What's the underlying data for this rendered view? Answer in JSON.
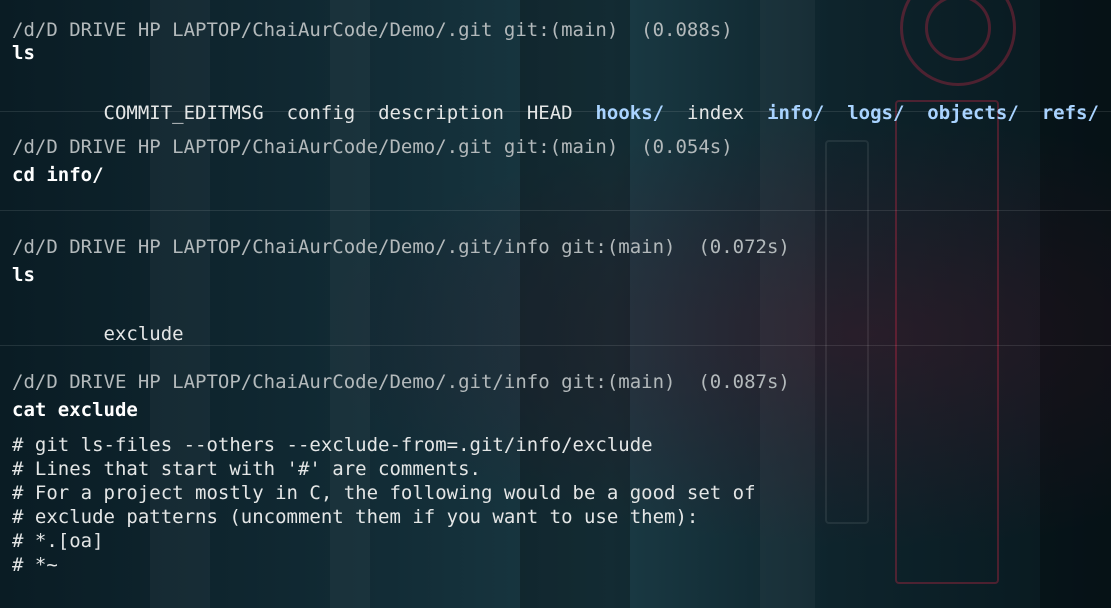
{
  "blocks": [
    {
      "prompt": "/d/D DRIVE HP LAPTOP/ChaiAurCode/Demo/.git git:(main)  (0.088s)",
      "command": "ls",
      "ls_items": [
        {
          "name": "COMMIT_EDITMSG",
          "is_dir": false
        },
        {
          "name": "config",
          "is_dir": false
        },
        {
          "name": "description",
          "is_dir": false
        },
        {
          "name": "HEAD",
          "is_dir": false
        },
        {
          "name": "hooks/",
          "is_dir": true
        },
        {
          "name": "index",
          "is_dir": false
        },
        {
          "name": "info/",
          "is_dir": true
        },
        {
          "name": "logs/",
          "is_dir": true
        },
        {
          "name": "objects/",
          "is_dir": true
        },
        {
          "name": "refs/",
          "is_dir": true
        }
      ]
    },
    {
      "prompt": "/d/D DRIVE HP LAPTOP/ChaiAurCode/Demo/.git git:(main)  (0.054s)",
      "command": "cd info/"
    },
    {
      "prompt": "/d/D DRIVE HP LAPTOP/ChaiAurCode/Demo/.git/info git:(main)  (0.072s)",
      "command": "ls",
      "output_lines": [
        "exclude"
      ]
    },
    {
      "prompt": "/d/D DRIVE HP LAPTOP/ChaiAurCode/Demo/.git/info git:(main)  (0.087s)",
      "command": "cat exclude",
      "output_lines": [
        "# git ls-files --others --exclude-from=.git/info/exclude",
        "# Lines that start with '#' are comments.",
        "# For a project mostly in C, the following would be a good set of",
        "# exclude patterns (uncomment them if you want to use them):",
        "# *.[oa]",
        "# *~"
      ]
    }
  ],
  "colors": {
    "prompt": "#b3b9bb",
    "command": "#ffffff",
    "directory": "#a9d3ff",
    "text": "#e4e6e6"
  }
}
